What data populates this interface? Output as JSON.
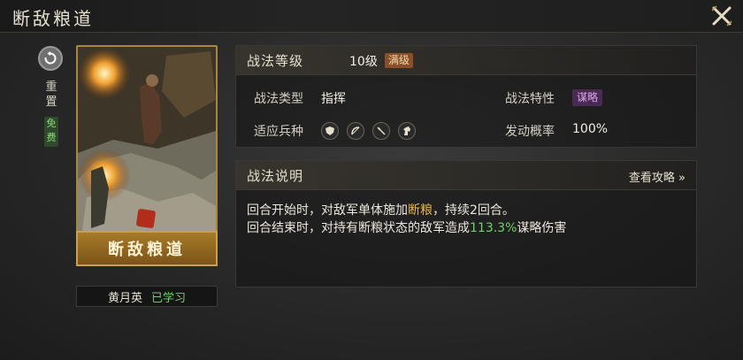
{
  "window": {
    "title": "断敌粮道"
  },
  "sidebar": {
    "reset_label": "重置",
    "free_label": "免费"
  },
  "card": {
    "name": "断敌粮道"
  },
  "owner": {
    "name": "黄月英",
    "status": "已学习"
  },
  "level": {
    "label": "战法等级",
    "value": "10级",
    "tag": "满级"
  },
  "attributes": {
    "type_label": "战法类型",
    "type_value": "指挥",
    "trait_label": "战法特性",
    "trait_value": "谋略",
    "troops_label": "适应兵种",
    "troops": [
      "shield-icon",
      "bow-icon",
      "spear-icon",
      "horse-icon"
    ],
    "rate_label": "发动概率",
    "rate_value": "100%"
  },
  "description": {
    "header": "战法说明",
    "guide_link": "查看攻略 »",
    "line1_pre": "回合开始时，对敌军单体施加",
    "line1_hl": "断粮",
    "line1_post": "，持续2回合。",
    "line2_pre": "回合结束时，对持有断粮状态的敌军造成",
    "line2_hl": "113.3%",
    "line2_post": "谋略伤害"
  },
  "colors": {
    "accent_gold": "#e8b54a",
    "accent_green": "#6fcf6a",
    "trait_purple": "#d8a6e6",
    "max_tag": "#8b4e2a"
  }
}
